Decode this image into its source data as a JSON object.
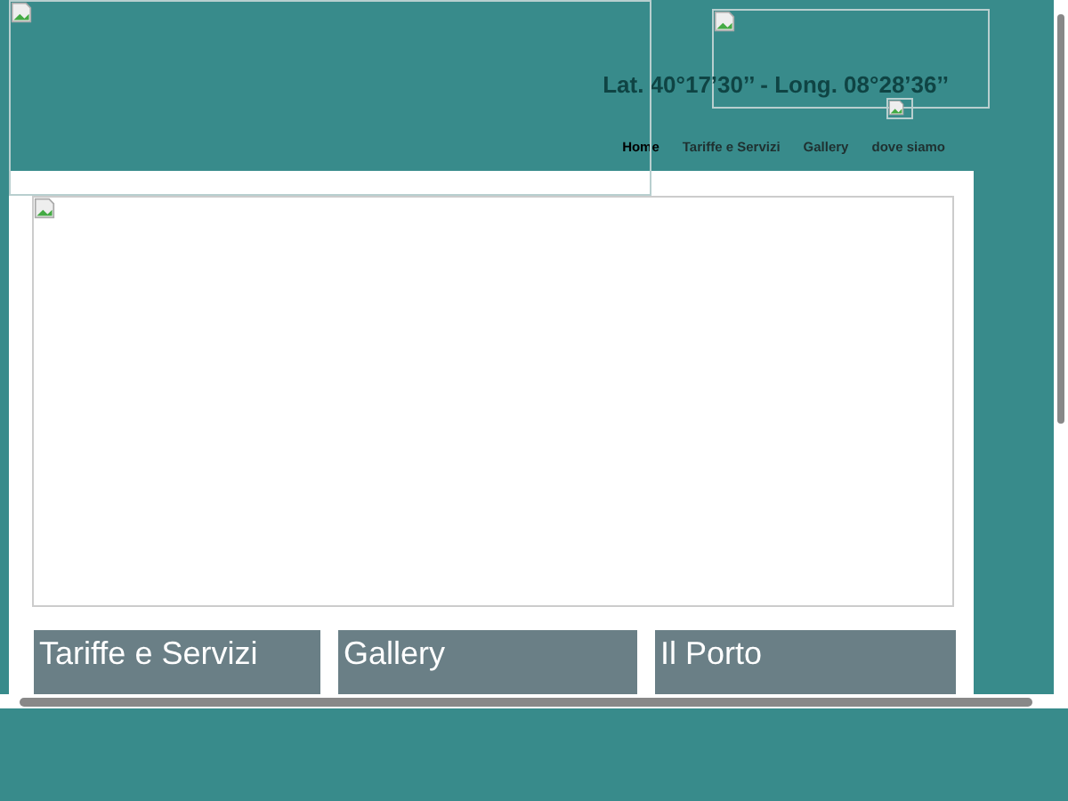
{
  "header": {
    "coordinates": "Lat. 40°17’30’’ - Long. 08°28’36’’"
  },
  "nav": [
    {
      "label": "Home",
      "selected": true
    },
    {
      "label": "Tariffe e Servizi",
      "selected": false
    },
    {
      "label": "Gallery",
      "selected": false
    },
    {
      "label": "dove siamo",
      "selected": false
    }
  ],
  "cards": [
    {
      "title": "Tariffe e Servizi"
    },
    {
      "title": "Gallery"
    },
    {
      "title": "Il Porto"
    }
  ]
}
